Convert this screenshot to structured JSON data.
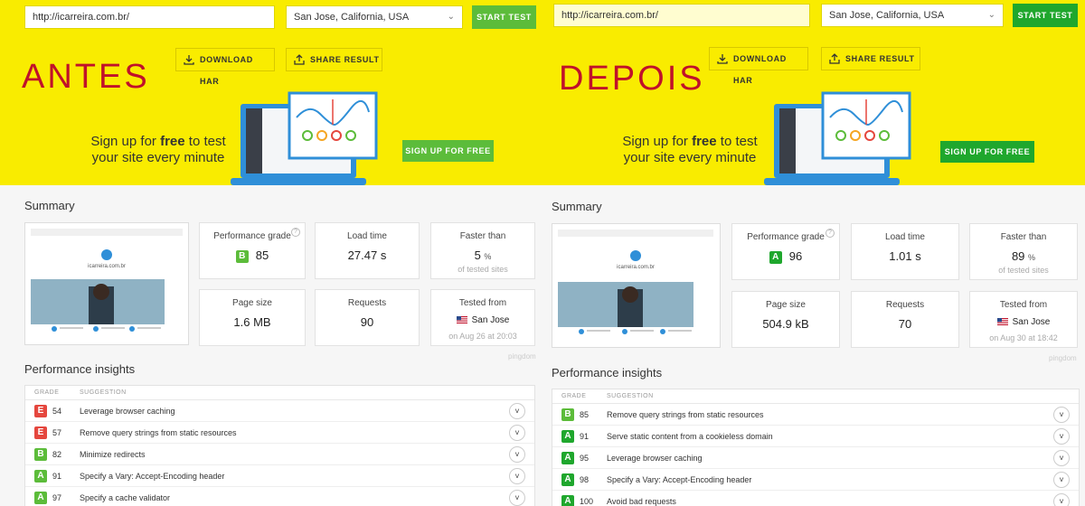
{
  "colors": {
    "hero_bg": "#f9ec00",
    "accent_green": "#5cbc3a",
    "title_red": "#c0112a",
    "grade_a": "#5cbc3a",
    "grade_b": "#5cbc3a",
    "grade_e": "#e5473e"
  },
  "panels": [
    {
      "label": "ANTES",
      "url": "http://icarreira.com.br/",
      "location": "San Jose, California, USA",
      "start_test": "START TEST",
      "download_har": "DOWNLOAD HAR",
      "share_result": "SHARE RESULT",
      "signup_line1_pre": "Sign up for ",
      "signup_line1_bold": "free",
      "signup_line1_post": " to test",
      "signup_line2": "your site every minute",
      "signup_button": "SIGN UP FOR FREE",
      "summary_title": "Summary",
      "perf_grade_label": "Performance grade",
      "perf_grade_letter": "B",
      "perf_grade_score": "85",
      "load_time_label": "Load time",
      "load_time": "27.47 s",
      "faster_than_label": "Faster than",
      "faster_than": "5",
      "faster_than_unit": "%",
      "faster_than_sub": "of tested sites",
      "page_size_label": "Page size",
      "page_size": "1.6 MB",
      "requests_label": "Requests",
      "requests": "90",
      "tested_from_label": "Tested from",
      "tested_from": "San Jose",
      "tested_on": "on Aug 26 at 20:03",
      "pingdom": "pingdom",
      "insights_title": "Performance insights",
      "col_grade": "GRADE",
      "col_suggestion": "SUGGESTION",
      "insights": [
        {
          "grade": "E",
          "score": "54",
          "text": "Leverage browser caching"
        },
        {
          "grade": "E",
          "score": "57",
          "text": "Remove query strings from static resources"
        },
        {
          "grade": "B",
          "score": "82",
          "text": "Minimize redirects"
        },
        {
          "grade": "A",
          "score": "91",
          "text": "Specify a Vary: Accept-Encoding header"
        },
        {
          "grade": "A",
          "score": "97",
          "text": "Specify a cache validator"
        }
      ],
      "thumb_site": "icarreira.com.br"
    },
    {
      "label": "DEPOIS",
      "url": "http://icarreira.com.br/",
      "location": "San Jose, California, USA",
      "start_test": "START TEST",
      "download_har": "DOWNLOAD HAR",
      "share_result": "SHARE RESULT",
      "signup_line1_pre": "Sign up for ",
      "signup_line1_bold": "free",
      "signup_line1_post": " to test",
      "signup_line2": "your site every minute",
      "signup_button": "SIGN UP FOR FREE",
      "summary_title": "Summary",
      "perf_grade_label": "Performance grade",
      "perf_grade_letter": "A",
      "perf_grade_score": "96",
      "load_time_label": "Load time",
      "load_time": "1.01 s",
      "faster_than_label": "Faster than",
      "faster_than": "89",
      "faster_than_unit": "%",
      "faster_than_sub": "of tested sites",
      "page_size_label": "Page size",
      "page_size": "504.9 kB",
      "requests_label": "Requests",
      "requests": "70",
      "tested_from_label": "Tested from",
      "tested_from": "San Jose",
      "tested_on": "on Aug 30 at 18:42",
      "pingdom": "pingdom",
      "insights_title": "Performance insights",
      "col_grade": "GRADE",
      "col_suggestion": "SUGGESTION",
      "insights": [
        {
          "grade": "B",
          "score": "85",
          "text": "Remove query strings from static resources"
        },
        {
          "grade": "A",
          "score": "91",
          "text": "Serve static content from a cookieless domain"
        },
        {
          "grade": "A",
          "score": "95",
          "text": "Leverage browser caching"
        },
        {
          "grade": "A",
          "score": "98",
          "text": "Specify a Vary: Accept-Encoding header"
        },
        {
          "grade": "A",
          "score": "100",
          "text": "Avoid bad requests"
        }
      ],
      "thumb_site": "icarreira.com.br"
    }
  ]
}
